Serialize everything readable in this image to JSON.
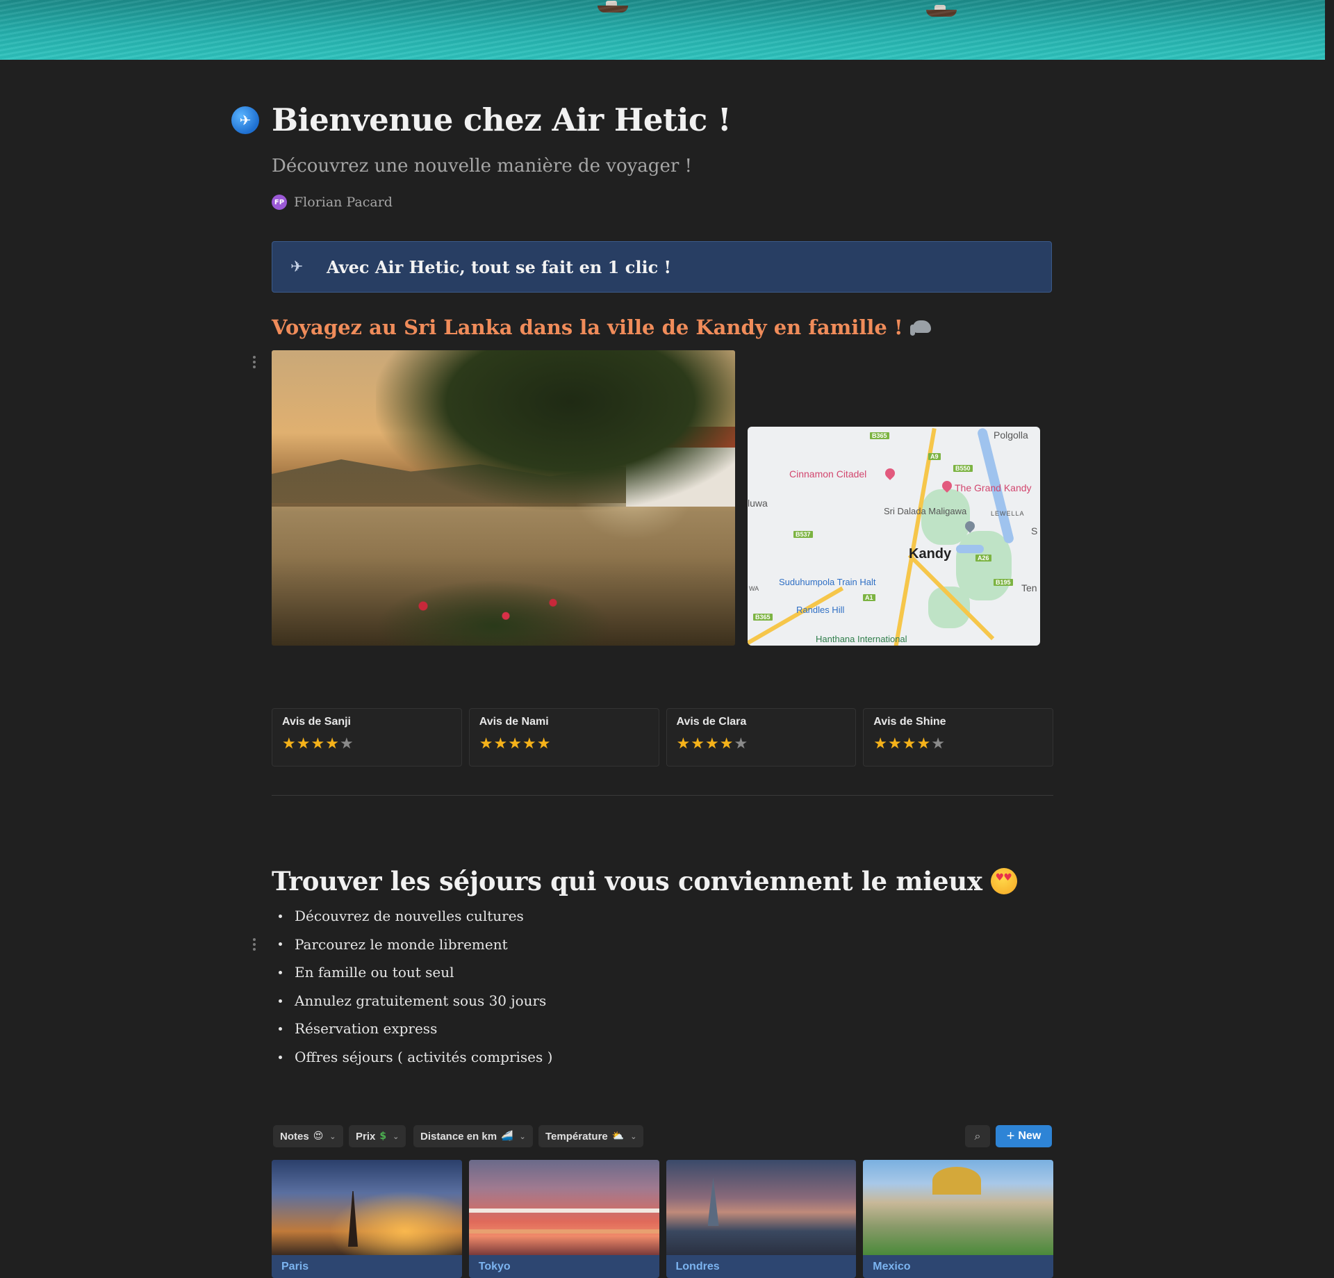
{
  "page": {
    "title": "Bienvenue chez Air Hetic !",
    "subtitle": "Découvrez une nouvelle manière de voyager !",
    "author": {
      "initials": "FP",
      "name": "Florian Pacard"
    }
  },
  "callout": {
    "text": "Avec Air Hetic, tout se fait en 1 clic !",
    "icon": "airplane-departure-icon"
  },
  "kandy": {
    "heading": "Voyagez au Sri Lanka dans la ville de Kandy en famille !",
    "heading_icon": "elephant-icon",
    "map_labels": {
      "city": "Kandy",
      "polgolla": "Polgolla",
      "cinnamon": "Cinnamon Citadel",
      "grand_kandy": "The Grand Kandy",
      "dalada": "Sri Dalada Maligawa",
      "lewella": "LEWELLA",
      "luwa": "luwa",
      "suduhumpola": "Suduhumpola Train Halt",
      "randles": "Randles Hill",
      "hanthana": "Hanthana International",
      "ten": "Ten",
      "wa": "WA",
      "s": "S",
      "b365_top": "B365",
      "a9": "A9",
      "b550": "B550",
      "b537": "B537",
      "a26": "A26",
      "b195": "B195",
      "a1": "A1",
      "b365_bottom": "B365"
    }
  },
  "reviews": [
    {
      "name": "Avis de Sanji",
      "rating": 4,
      "max": 5
    },
    {
      "name": "Avis de Nami",
      "rating": 5,
      "max": 5
    },
    {
      "name": "Avis de Clara",
      "rating": 4,
      "max": 5
    },
    {
      "name": "Avis de Shine",
      "rating": 4,
      "max": 5
    }
  ],
  "stays": {
    "heading": "Trouver les séjours qui vous conviennent le mieux",
    "heading_icon": "heart-eyes-emoji-icon",
    "bullets": [
      "Découvrez de nouvelles cultures",
      "Parcourez le monde librement",
      "En famille ou tout seul",
      "Annulez gratuitement sous 30 jours",
      "Réservation express",
      "Offres séjours ( activités comprises )"
    ]
  },
  "database": {
    "filters": [
      {
        "label": "Notes",
        "emoji": "😍"
      },
      {
        "label": "Prix",
        "emoji": "$"
      },
      {
        "label": "Distance en km",
        "emoji": "🚄"
      },
      {
        "label": "Température",
        "emoji": "⛅"
      }
    ],
    "new_label": "New",
    "cards": [
      "Paris",
      "Tokyo",
      "Londres",
      "Mexico"
    ]
  },
  "colors": {
    "background": "#202020",
    "callout_bg": "#283e63",
    "accent_orange": "#f08c5a",
    "star": "#f5b21a",
    "new_button": "#2e84d6",
    "card_label": "#7cb4f0"
  }
}
